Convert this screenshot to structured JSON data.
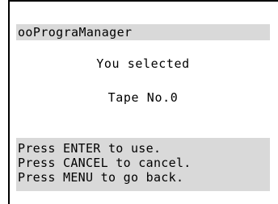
{
  "screen": {
    "title": "ooPrograManager",
    "message_line_1": "You selected",
    "message_line_2": "Tape No.0",
    "footer_lines": [
      "Press ENTER to use.",
      "Press CANCEL to cancel.",
      "Press MENU to go back."
    ]
  },
  "colors": {
    "background": "#ffffff",
    "bar": "#d9d9d9",
    "text": "#000000"
  }
}
